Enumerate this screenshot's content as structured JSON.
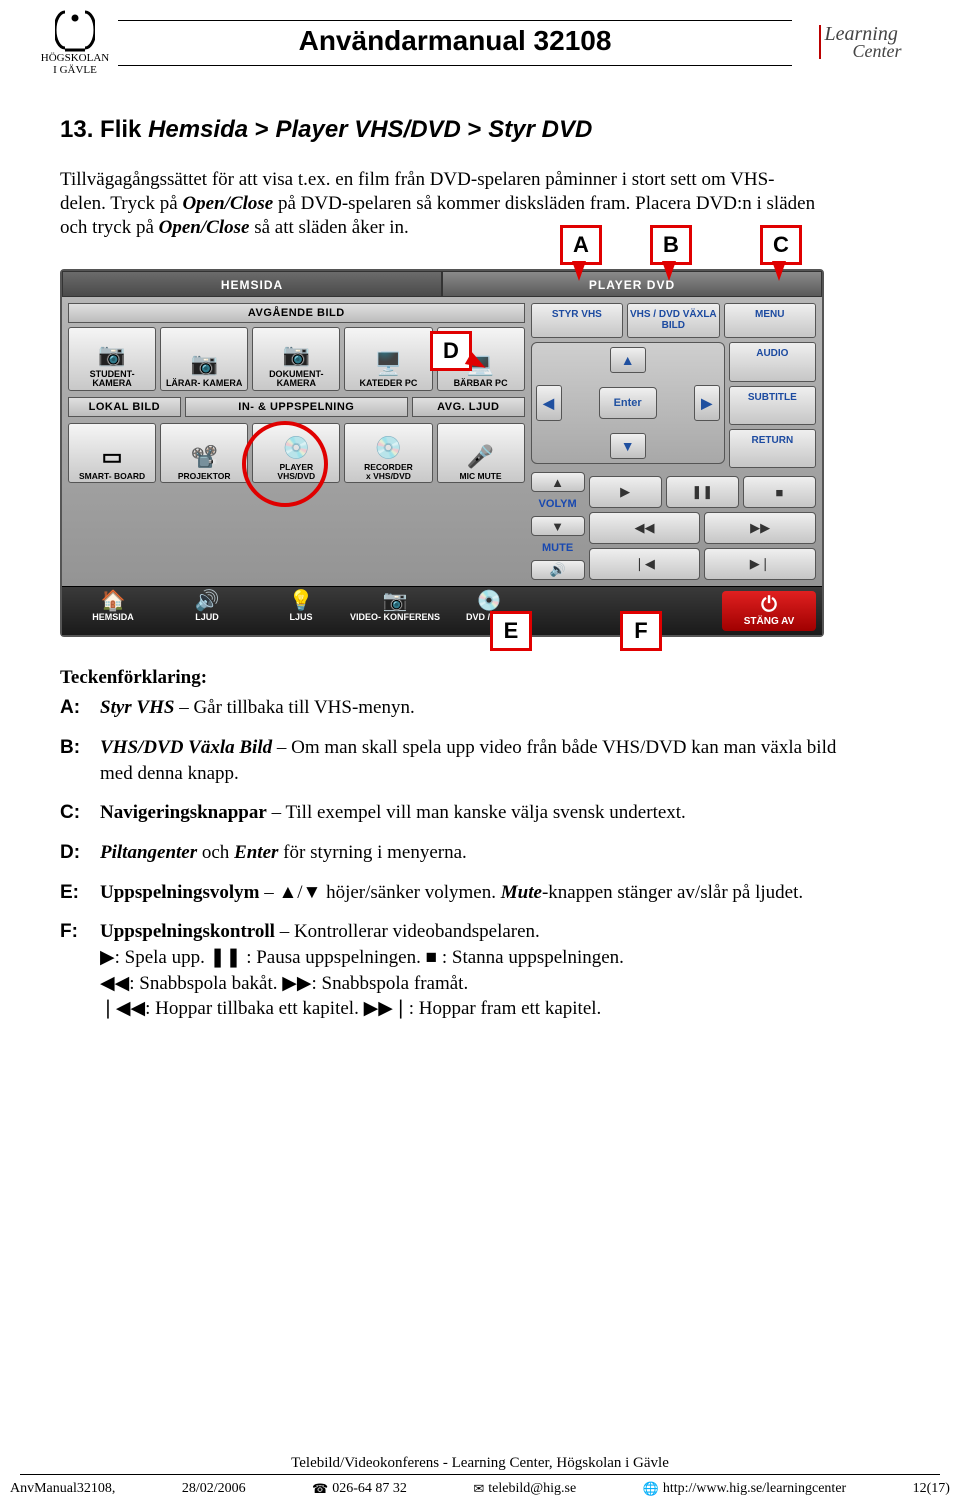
{
  "header": {
    "logo_line1": "HÖGSKOLAN",
    "logo_line2": "I GÄVLE",
    "title": "Användarmanual 32108",
    "right_logo_l1": "Learning",
    "right_logo_l2": "Center"
  },
  "section": {
    "number": "13.",
    "prefix": "Flik ",
    "crumb1": "Hemsida",
    "sep": " > ",
    "crumb2": "Player VHS/DVD",
    "crumb3": "Styr DVD"
  },
  "intro": {
    "p1a": "Tillvägagångssättet för att visa t.ex. en film från DVD-spelaren påminner i stort sett om VHS-delen. Tryck på ",
    "oc1": "Open/Close",
    "p1b": " på DVD-spelaren så kommer disksläden fram. Placera DVD:n i släden och tryck på ",
    "oc2": "Open/Close",
    "p1c": " så att släden åker in."
  },
  "callouts": {
    "A": "A",
    "B": "B",
    "C": "C",
    "D": "D",
    "E": "E",
    "F": "F"
  },
  "panel": {
    "tab_left": "HEMSIDA",
    "tab_right": "PLAYER DVD",
    "avg_bild": "AVGÅENDE BILD",
    "student": "STUDENT-\nKAMERA",
    "larar": "LÄRAR-\nKAMERA",
    "dokument": "DOKUMENT-\nKAMERA",
    "kateder": "KATEDER PC",
    "barbar": "BÄRBAR PC",
    "lokal": "LOKAL BILD",
    "inupp": "IN- & UPPSPELNING",
    "avgljud": "AVG. LJUD",
    "smart": "SMART-\nBOARD",
    "projektor": "PROJEKTOR",
    "player": "PLAYER",
    "vhsdvd": "VHS/DVD",
    "recorder": "RECORDER",
    "xvhs": "x VHS/DVD",
    "mic": "MIC\nMUTE",
    "styrvhs": "STYR\nVHS",
    "vaxla": "VHS / DVD\nVÄXLA BILD",
    "menu": "MENU",
    "audio": "AUDIO",
    "subtitle": "SUBTITLE",
    "return": "RETURN",
    "enter": "Enter",
    "volym": "VOLYM",
    "mute": "MUTE",
    "nav_hemsida": "HEMSIDA",
    "nav_ljud": "LJUD",
    "nav_ljus": "LJUS",
    "nav_video": "VIDEO-\nKONFERENS",
    "nav_dvd": "DVD / HDD",
    "nav_off": "STÄNG\nAV"
  },
  "legend": {
    "heading": "Teckenförklaring:",
    "A": {
      "k": "A:",
      "t1": "Styr VHS",
      "t2": " – Går tillbaka till VHS-menyn."
    },
    "B": {
      "k": "B:",
      "t1": "VHS/DVD Växla Bild",
      "t2": " – Om man skall spela upp video från både VHS/DVD kan man växla bild med denna knapp."
    },
    "C": {
      "k": "C:",
      "t1": "Navigeringsknappar",
      "t2": " – Till exempel vill man kanske välja svensk undertext."
    },
    "D": {
      "k": "D:",
      "t1": "Piltangenter",
      "mid": " och ",
      "t1b": "Enter",
      "t2": " för styrning i menyerna."
    },
    "E": {
      "k": "E:",
      "t1": "Uppspelningsvolym",
      "t2a": " – ▲/▼ höjer/sänker volymen. ",
      "mute": "Mute",
      "t2b": "-knappen stänger av/slår på ljudet."
    },
    "F": {
      "k": "F:",
      "t1": "Uppspelningskontroll",
      "t2": " – Kontrollerar videobandspelaren.",
      "l2": "▶: Spela upp.  ❚❚ : Pausa uppspelningen.  ■ : Stanna uppspelningen.",
      "l3": "◀◀: Snabbspola bakåt.  ▶▶: Snabbspola framåt.",
      "l4": "❘◀◀: Hoppar tillbaka ett kapitel.  ▶▶❘: Hoppar fram ett kapitel."
    }
  },
  "footer": {
    "line1": "Telebild/Videokonferens - Learning Center, Högskolan i Gävle",
    "f1": "AnvManual32108,",
    "f2": "28/02/2006",
    "f3": "026-64 87 32",
    "f4": "telebild@hig.se",
    "f5": "http://www.hig.se/learningcenter",
    "f6": "12(17)"
  }
}
